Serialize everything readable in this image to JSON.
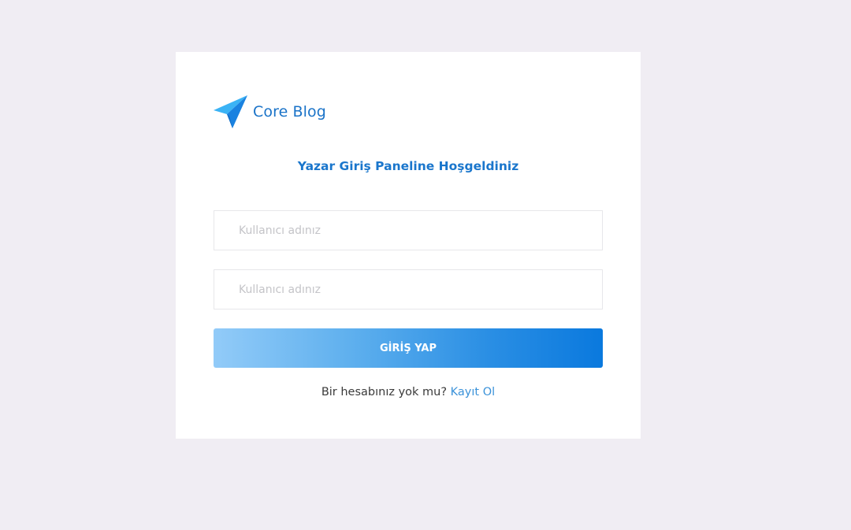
{
  "brand": {
    "name": "Core Blog",
    "logo_icon": "paper-plane-icon",
    "logo_color_light": "#3bb3f5",
    "logo_color_dark": "#1a82e0"
  },
  "welcome": {
    "title": "Yazar Giriş Paneline Hoşgeldiniz"
  },
  "form": {
    "username": {
      "placeholder": "Kullanıcı adınız",
      "value": ""
    },
    "password": {
      "placeholder": "Kullanıcı adınız",
      "value": ""
    },
    "submit_label": "GİRİŞ YAP"
  },
  "signup": {
    "prompt": "Bir hesabınız yok mu?",
    "link_label": "Kayıt Ol"
  },
  "colors": {
    "background": "#f0edf3",
    "card": "#ffffff",
    "accent": "#1a76cc",
    "button_gradient_start": "#92cbf8",
    "button_gradient_end": "#0a79de",
    "link": "#3b92d9"
  }
}
